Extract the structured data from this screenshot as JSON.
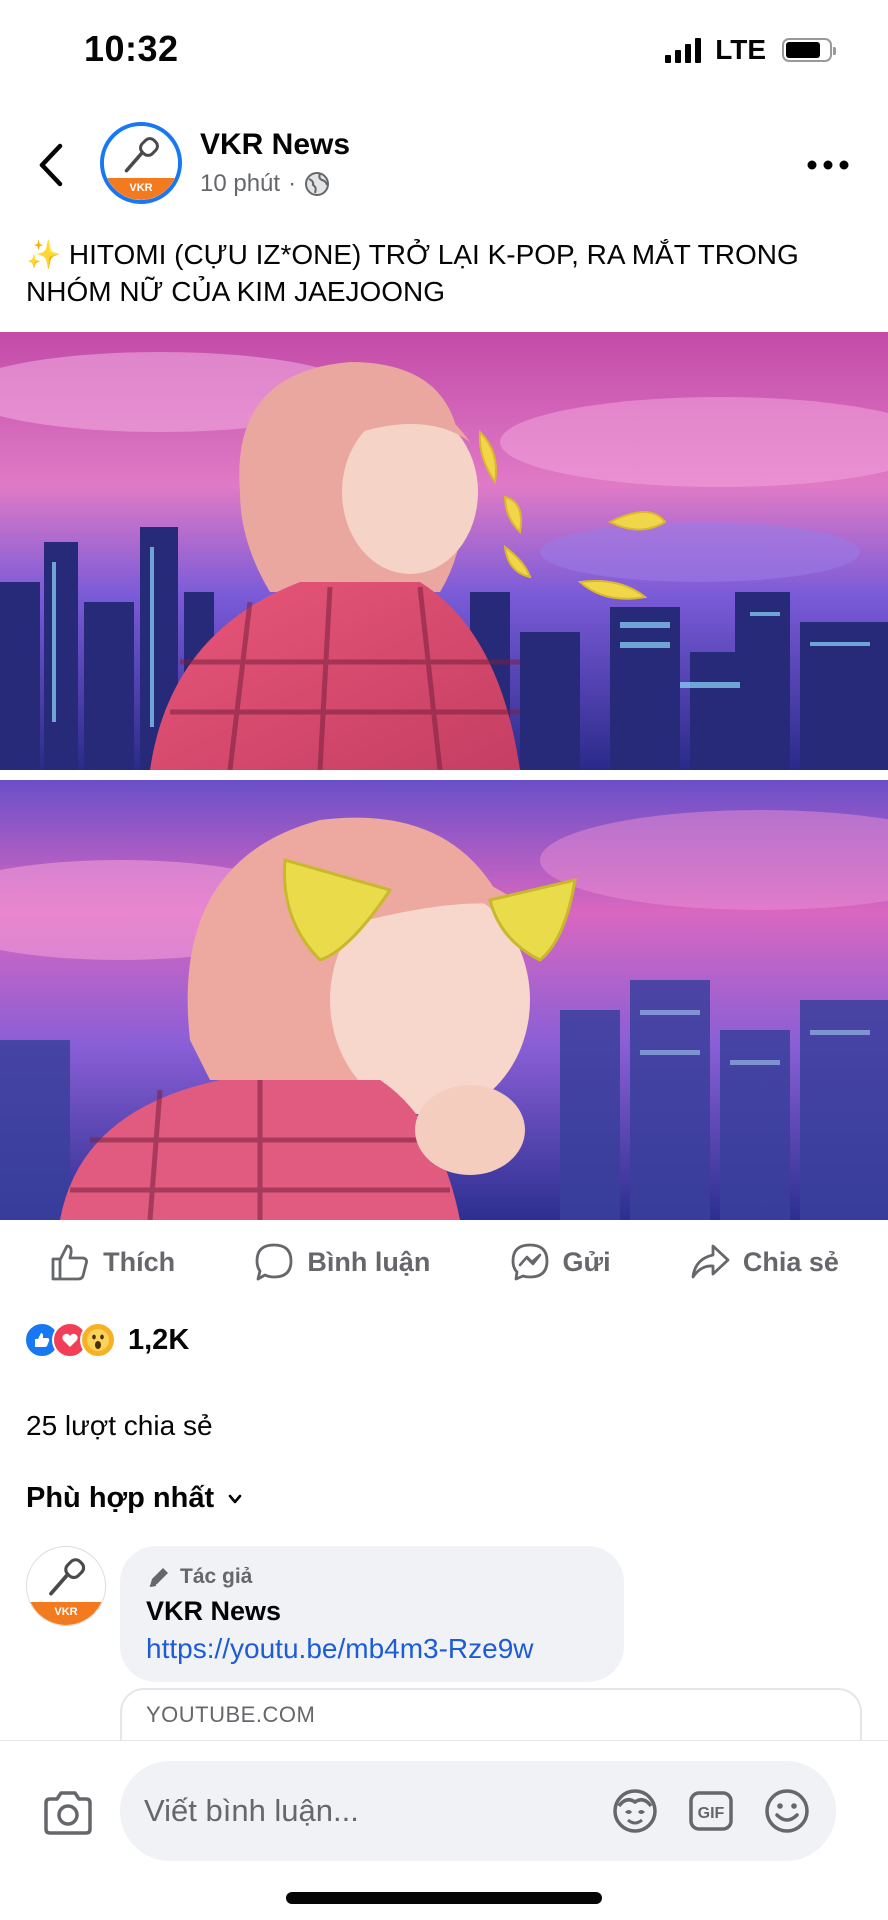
{
  "status_bar": {
    "time": "10:32",
    "network": "LTE"
  },
  "post": {
    "page_name": "VKR News",
    "time_ago": "10 phút",
    "separator": "·",
    "privacy_icon": "globe-icon",
    "avatar_text": "VKR",
    "caption_emoji": "✨",
    "caption_text": "HITOMI (CỰU IZ*ONE) TRỞ LẠI K-POP, RA MẮT TRONG NHÓM NỮ CỦA KIM JAEJOONG",
    "photo_count": 2
  },
  "actions": {
    "like": "Thích",
    "comment": "Bình luận",
    "send": "Gửi",
    "share": "Chia sẻ"
  },
  "reactions": {
    "types": [
      "like",
      "love",
      "wow"
    ],
    "count": "1,2K"
  },
  "shares_text": "25 lượt chia sẻ",
  "sort_label": "Phù hợp nhất",
  "comment": {
    "badge": "Tác giả",
    "author": "VKR News",
    "link": "https://youtu.be/mb4m3-Rze9w",
    "preview_domain": "YOUTUBE.COM"
  },
  "composer": {
    "placeholder": "Viết bình luận..."
  },
  "colors": {
    "brand_blue": "#1877f2",
    "avatar_orange": "#f47a20",
    "secondary_text": "#65676b",
    "link_blue": "#1d5cd6"
  }
}
